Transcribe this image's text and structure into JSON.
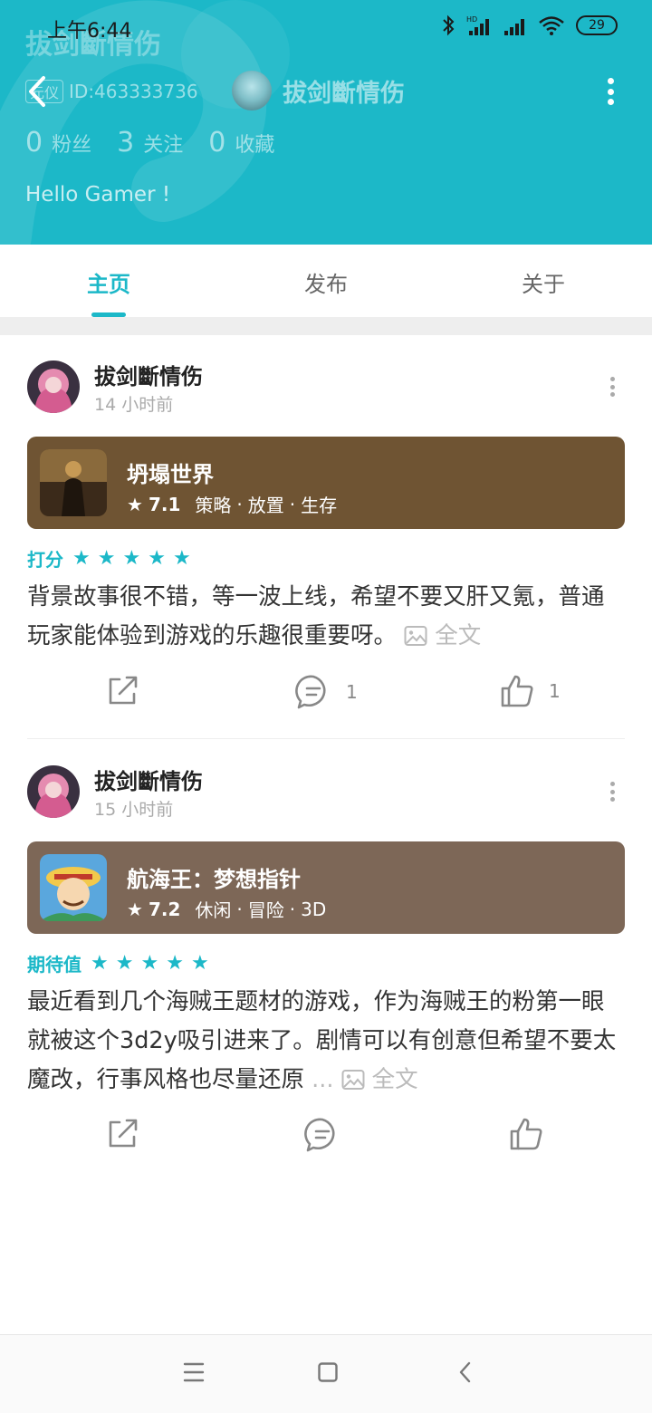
{
  "status_bar": {
    "time": "上午6:44",
    "battery": "29",
    "network_badge": "HD"
  },
  "header": {
    "ghost_title": "拔剑斷情伤",
    "id_tag": "元仪",
    "id_text": "ID:463333736",
    "name": "拔剑斷情伤",
    "stats": [
      {
        "num": "0",
        "label": "粉丝"
      },
      {
        "num": "3",
        "label": "关注"
      },
      {
        "num": "0",
        "label": "收藏"
      }
    ],
    "bio": "Hello Gamer !",
    "bg_color": "#1cb8c8"
  },
  "tabs": [
    {
      "label": "主页",
      "active": true
    },
    {
      "label": "发布",
      "active": false
    },
    {
      "label": "关于",
      "active": false
    }
  ],
  "posts": [
    {
      "username": "拔剑斷情伤",
      "time": "14 小时前",
      "game": {
        "name": "坍塌世界",
        "score": "7.1",
        "tags": [
          "策略",
          "放置",
          "生存"
        ],
        "card_color": "#6f5433"
      },
      "rating_label": "打分",
      "stars": 5,
      "text": "背景故事很不错，等一波上线，希望不要又肝又氪，普通玩家能体验到游戏的乐趣很重要呀。",
      "full_label": "全文",
      "comments": "1",
      "likes": "1"
    },
    {
      "username": "拔剑斷情伤",
      "time": "15 小时前",
      "game": {
        "name": "航海王：梦想指针",
        "score": "7.2",
        "tags": [
          "休闲",
          "冒险",
          "3D"
        ],
        "card_color": "#7d6757"
      },
      "rating_label": "期待值",
      "stars": 5,
      "text": "最近看到几个海贼王题材的游戏，作为海贼王的粉第一眼就被这个3d2y吸引进来了。剧情可以有创意但希望不要太魔改，行事风格也尽量还原",
      "ellipsis": "...",
      "full_label": "全文",
      "comments": "",
      "likes": ""
    }
  ]
}
